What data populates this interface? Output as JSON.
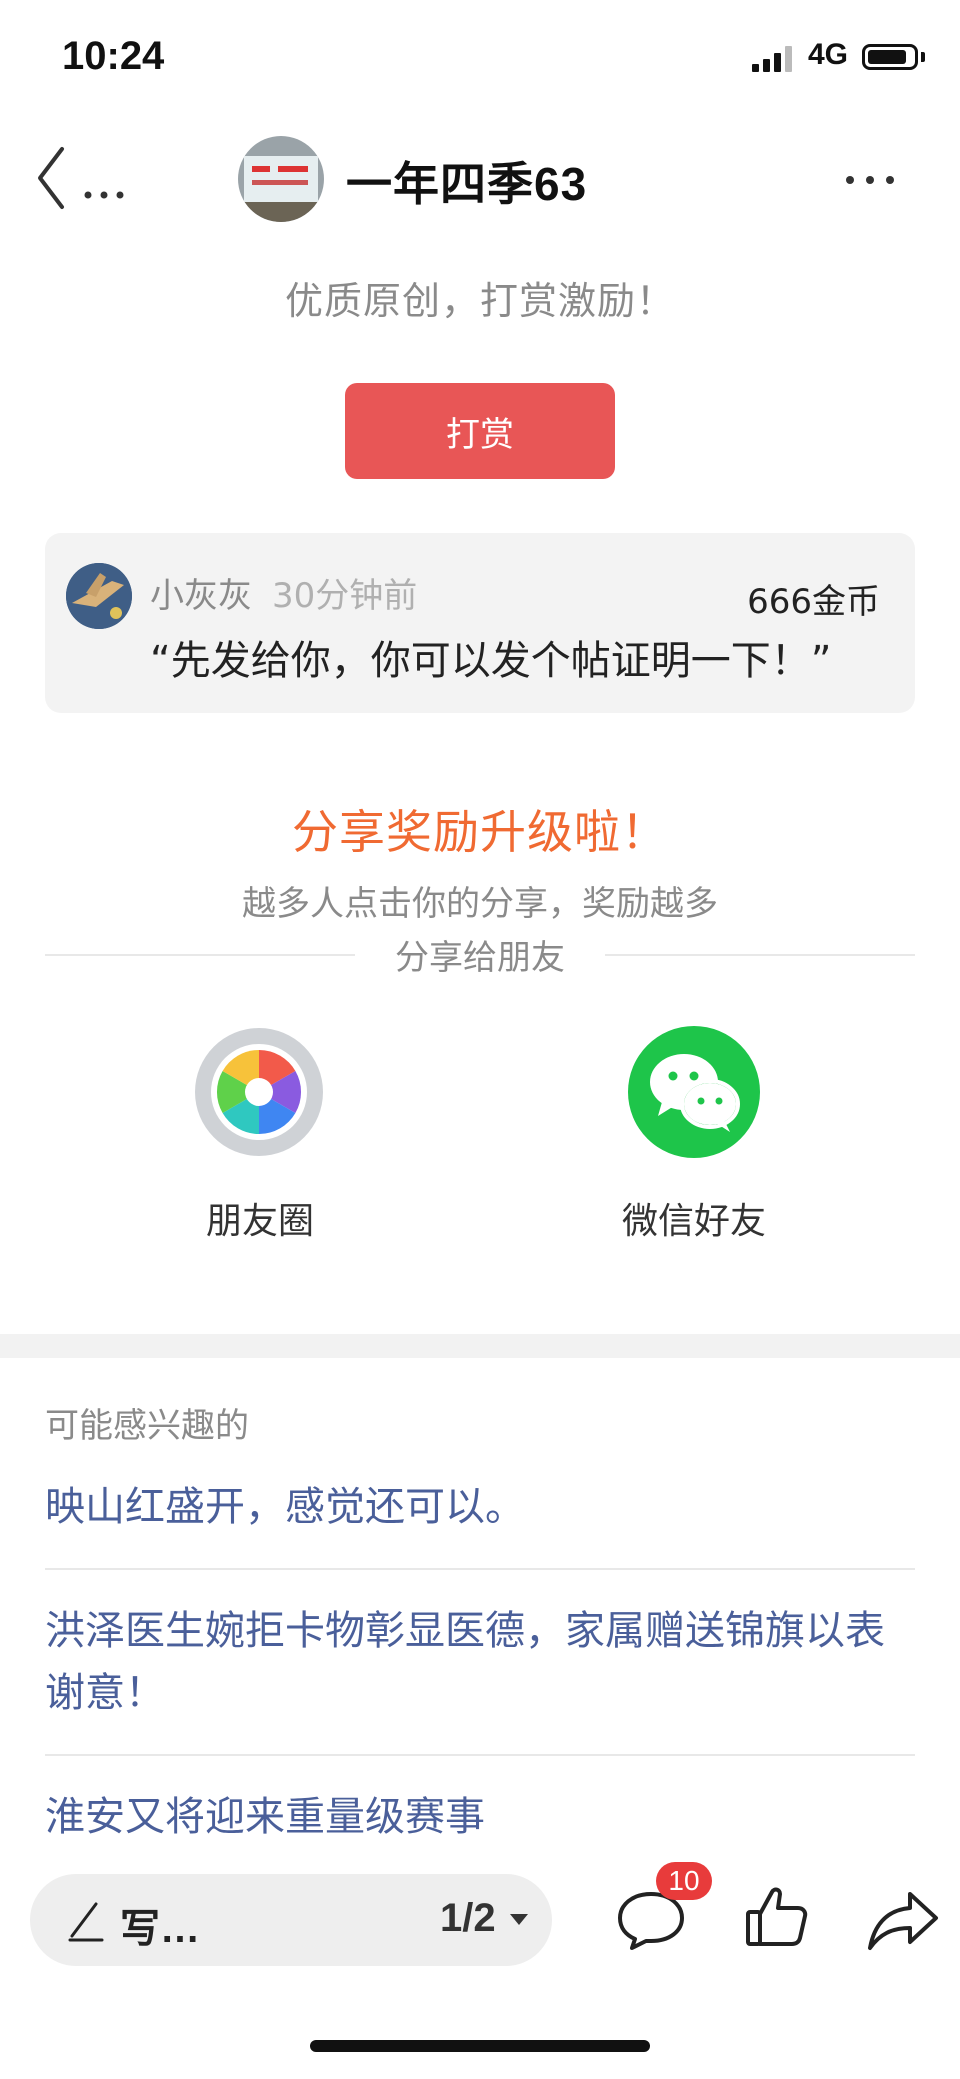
{
  "status_bar": {
    "time": "10:24",
    "network": "4G"
  },
  "header": {
    "author_name": "一年四季63"
  },
  "tagline": "优质原创，打赏激励！",
  "tip_button_label": "打赏",
  "tip_record": {
    "user": "小灰灰",
    "time": "30分钟前",
    "amount": "666金币",
    "message": "“先发给你，你可以发个帖证明一下！”"
  },
  "share": {
    "title": "分享奖励升级啦！",
    "subtitle": "越多人点击你的分享，奖励越多",
    "share_to": "分享给朋友",
    "targets": [
      {
        "label": "朋友圈",
        "icon": "moments-camera-icon"
      },
      {
        "label": "微信好友",
        "icon": "wechat-icon"
      }
    ]
  },
  "interest": {
    "heading": "可能感兴趣的",
    "articles": [
      {
        "title": "映山红盛开，感觉还可以。"
      },
      {
        "title": "洪泽医生婉拒卡物彰显医德，家属赠送锦旗以表谢意！"
      },
      {
        "title": "淮安又将迎来重量级赛事"
      }
    ]
  },
  "bottom_bar": {
    "write_placeholder": "写…",
    "page_indicator": "1/2",
    "comment_count": "10"
  },
  "colors": {
    "accent_red": "#e85656",
    "share_orange": "#f06a32",
    "link_blue": "#4a5f9a",
    "wechat_green": "#1ec54a"
  }
}
